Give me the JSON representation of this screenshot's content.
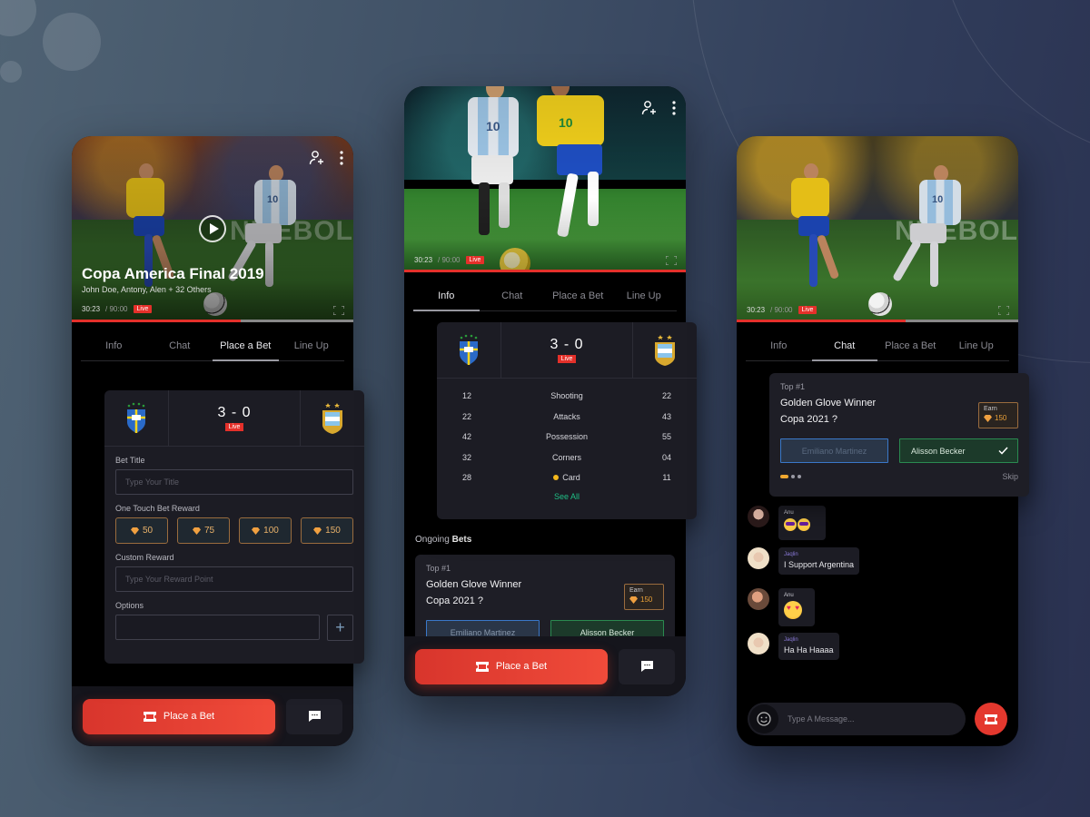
{
  "tabs": [
    "Info",
    "Chat",
    "Place a Bet",
    "Line Up"
  ],
  "video": {
    "current_time": "30:23",
    "duration": "/ 90:00",
    "live_label": "Live",
    "progress_fraction": 0.6
  },
  "match": {
    "score": "3 - 0",
    "live_label": "Live",
    "home_team": "Brazil",
    "away_team": "Argentina"
  },
  "phone1": {
    "title": "Copa America Final 2019",
    "subtitle": "John Doe, Antony, Alen + 32 Others",
    "active_tab": "Place a Bet",
    "banner_text": "NMEBOL",
    "form": {
      "bet_title_label": "Bet Title",
      "bet_title_placeholder": "Type Your Title",
      "one_touch_label": "One Touch Bet Reward",
      "rewards": [
        "50",
        "75",
        "100",
        "150"
      ],
      "custom_reward_label": "Custom Reward",
      "custom_reward_placeholder": "Type Your Reward Point",
      "options_label": "Options",
      "options_value": "",
      "add_option_symbol": "+"
    }
  },
  "phone2": {
    "active_tab": "Info",
    "stats": [
      {
        "home": "12",
        "label": "Shooting",
        "away": "22"
      },
      {
        "home": "22",
        "label": "Attacks",
        "away": "43"
      },
      {
        "home": "42",
        "label": "Possession",
        "away": "55"
      },
      {
        "home": "32",
        "label": "Corners",
        "away": "04"
      },
      {
        "home": "28",
        "label": "Card",
        "away": "11",
        "marker": "yellow-card"
      }
    ],
    "see_all": "See All",
    "ongoing_prefix": "Ongoing",
    "ongoing_bold": "Bets"
  },
  "bet": {
    "rank": "Top #1",
    "question_line1": "Golden Glove Winner",
    "question_line2": "Copa 2021 ?",
    "earn_label": "Earn",
    "earn_value": "150",
    "option_a": "Emiliano Martinez",
    "option_b": "Alisson Becker",
    "selected": "Alisson Becker",
    "skip": "Skip",
    "page_index": 1,
    "page_count": 3
  },
  "bottom_bar": {
    "place_bet_label": "Place a Bet"
  },
  "phone3": {
    "active_tab": "Chat",
    "banner_text": "NMEBOL",
    "messages": [
      {
        "name": "Anu",
        "text": "",
        "emoji": "smiling-face-with-sunglasses x2"
      },
      {
        "name": "Jaqlin",
        "text": "I Support Argentina"
      },
      {
        "name": "Anu",
        "text": "",
        "emoji": "smiling-face-with-heart-eyes"
      },
      {
        "name": "Jaqlin",
        "text": "Ha Ha Haaaa"
      }
    ],
    "composer_placeholder": "Type A Message..."
  },
  "colors": {
    "accent_red": "#e4302a",
    "reward_gold": "#e8a038",
    "see_all_green": "#1fbf86",
    "selected_green": "#2a8a50",
    "option_blue": "#3a78c8"
  }
}
